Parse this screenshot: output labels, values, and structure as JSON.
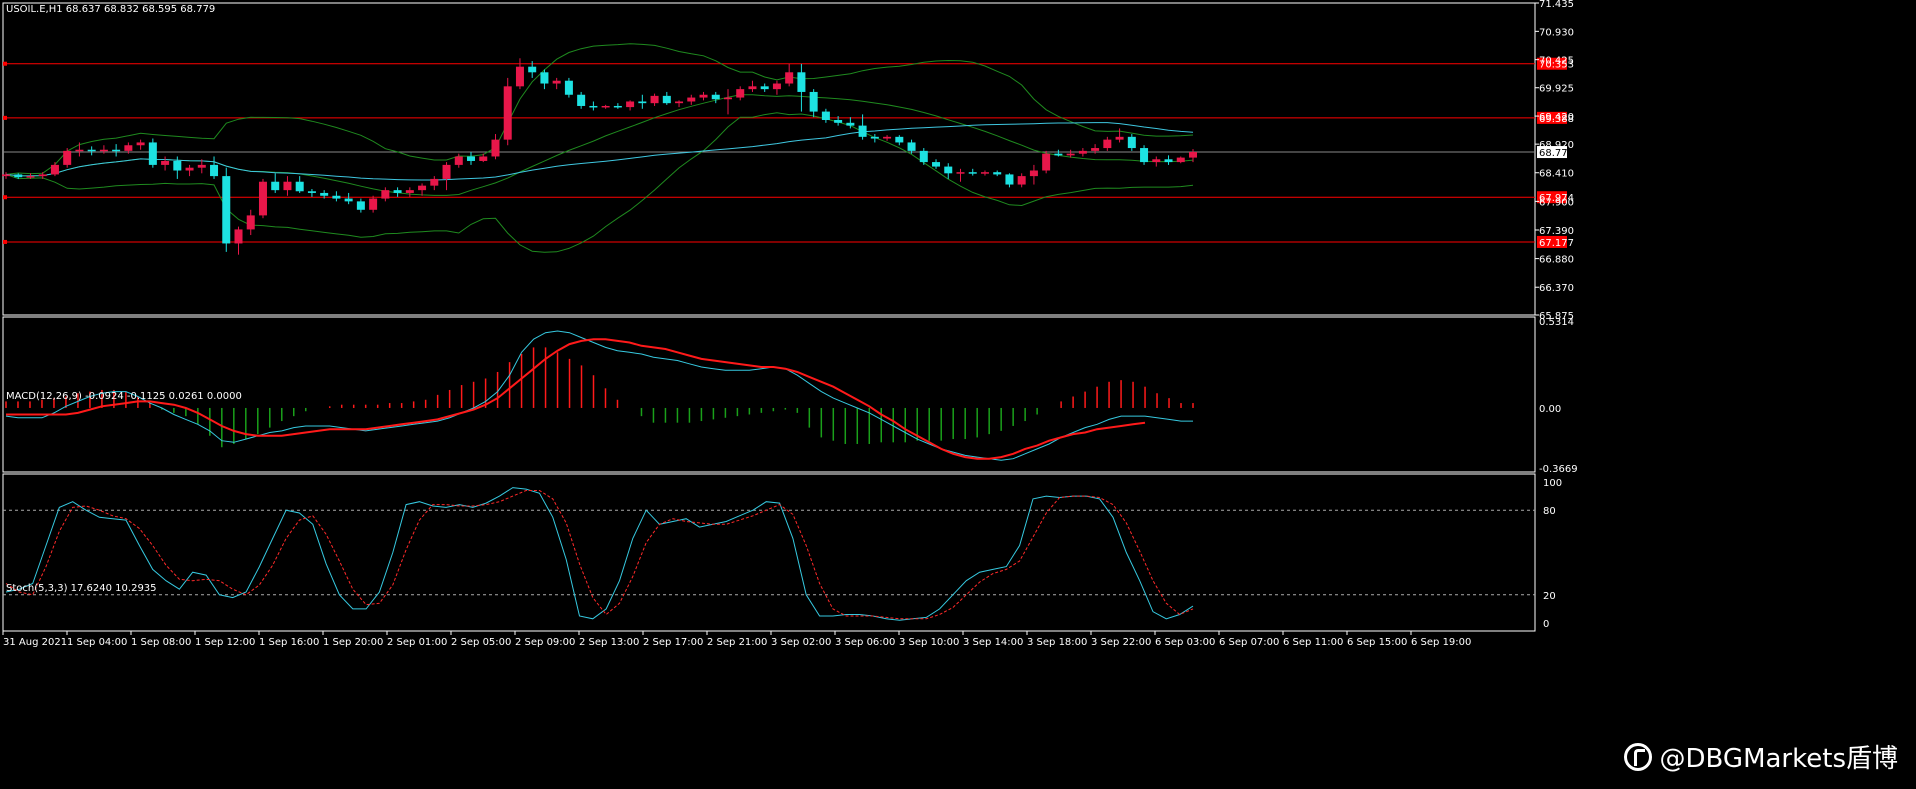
{
  "colors": {
    "background": "#000000",
    "frame": "#ffffff",
    "bull": "#e8174a",
    "bear": "#1de2e2",
    "level": "#ff0000",
    "bands": "#1f8a1f",
    "ma": "#3fc7e0",
    "macd_main": "#ff1a1a",
    "macd_signal": "#36c9e0",
    "hist_pos": "#ff1a1a",
    "hist_neg": "#1aa01a",
    "stoch_main": "#36c9e0",
    "stoch_signal": "#ff2a2a",
    "label_bg": "#ff0000",
    "price_bg": "#ffffff"
  },
  "header": {
    "symbol_info": "USOIL.E,H1  68.637 68.832 68.595 68.779"
  },
  "macd_header": "MACD(12,26,9) -0.0924 -0.1125 0.0261 0.0000",
  "stoch_header": "Stoch(5,3,3) 17.6240 10.2935",
  "watermark": "@DBGMarkets盾博",
  "chart_data": [
    {
      "type": "candlestick",
      "title": "USOIL.E,H1",
      "ohlc_last": [
        68.637,
        68.832,
        68.595,
        68.779
      ],
      "ylim": [
        65.875,
        71.435
      ],
      "yticks": [
        71.435,
        70.93,
        70.425,
        69.925,
        69.42,
        68.92,
        68.41,
        67.9,
        67.39,
        66.88,
        66.37,
        65.875
      ],
      "ytick_labels": [
        "71.435",
        "70.930",
        "70.425",
        "69.925",
        "69.420",
        "68.920",
        "68.410",
        "67.900",
        "67.390",
        "66.880",
        "66.370",
        "65.875"
      ],
      "levels": [
        {
          "value": 70.353,
          "label": "70.353"
        },
        {
          "value": 69.388,
          "label": "69.388"
        },
        {
          "value": 67.974,
          "label": "67.974"
        },
        {
          "value": 67.177,
          "label": "67.177"
        }
      ],
      "current_price": {
        "value": 68.779,
        "label": "68.779"
      },
      "x_labels": [
        "31 Aug 2021",
        "1 Sep 04:00",
        "1 Sep 08:00",
        "1 Sep 12:00",
        "1 Sep 16:00",
        "1 Sep 20:00",
        "2 Sep 01:00",
        "2 Sep 05:00",
        "2 Sep 09:00",
        "2 Sep 13:00",
        "2 Sep 17:00",
        "2 Sep 21:00",
        "3 Sep 02:00",
        "3 Sep 06:00",
        "3 Sep 10:00",
        "3 Sep 14:00",
        "3 Sep 18:00",
        "3 Sep 22:00",
        "6 Sep 03:00",
        "6 Sep 07:00",
        "6 Sep 11:00",
        "6 Sep 15:00",
        "6 Sep 19:00"
      ],
      "candles": [
        [
          68.35,
          68.42,
          68.3,
          68.38
        ],
        [
          68.38,
          68.4,
          68.3,
          68.33
        ],
        [
          68.33,
          68.4,
          68.3,
          68.35
        ],
        [
          68.35,
          68.42,
          68.3,
          68.38
        ],
        [
          68.38,
          68.6,
          68.35,
          68.55
        ],
        [
          68.55,
          68.85,
          68.5,
          68.8
        ],
        [
          68.8,
          68.95,
          68.7,
          68.82
        ],
        [
          68.82,
          68.88,
          68.72,
          68.8
        ],
        [
          68.8,
          68.9,
          68.75,
          68.82
        ],
        [
          68.82,
          68.92,
          68.7,
          68.8
        ],
        [
          68.8,
          68.95,
          68.75,
          68.9
        ],
        [
          68.9,
          69.0,
          68.82,
          68.95
        ],
        [
          68.95,
          69.02,
          68.5,
          68.55
        ],
        [
          68.55,
          68.7,
          68.45,
          68.62
        ],
        [
          68.62,
          68.7,
          68.3,
          68.45
        ],
        [
          68.45,
          68.55,
          68.35,
          68.5
        ],
        [
          68.5,
          68.65,
          68.4,
          68.55
        ],
        [
          68.55,
          68.7,
          68.3,
          68.35
        ],
        [
          68.35,
          68.5,
          67.0,
          67.15
        ],
        [
          67.15,
          67.45,
          66.95,
          67.4
        ],
        [
          67.4,
          67.75,
          67.3,
          67.65
        ],
        [
          67.65,
          68.3,
          67.6,
          68.25
        ],
        [
          68.25,
          68.4,
          68.05,
          68.1
        ],
        [
          68.1,
          68.35,
          68.0,
          68.25
        ],
        [
          68.25,
          68.35,
          68.05,
          68.08
        ],
        [
          68.08,
          68.12,
          67.98,
          68.05
        ],
        [
          68.05,
          68.1,
          67.95,
          68.0
        ],
        [
          68.0,
          68.08,
          67.9,
          67.95
        ],
        [
          67.95,
          68.05,
          67.85,
          67.9
        ],
        [
          67.9,
          67.95,
          67.7,
          67.75
        ],
        [
          67.75,
          68.0,
          67.7,
          67.95
        ],
        [
          67.95,
          68.15,
          67.9,
          68.1
        ],
        [
          68.1,
          68.15,
          67.98,
          68.05
        ],
        [
          68.05,
          68.15,
          67.98,
          68.1
        ],
        [
          68.1,
          68.22,
          68.0,
          68.18
        ],
        [
          68.18,
          68.35,
          68.1,
          68.3
        ],
        [
          68.3,
          68.6,
          68.1,
          68.55
        ],
        [
          68.55,
          68.75,
          68.5,
          68.7
        ],
        [
          68.7,
          68.78,
          68.55,
          68.62
        ],
        [
          68.62,
          68.75,
          68.6,
          68.7
        ],
        [
          68.7,
          69.1,
          68.65,
          69.0
        ],
        [
          69.0,
          70.1,
          68.9,
          69.95
        ],
        [
          69.95,
          70.45,
          69.9,
          70.3
        ],
        [
          70.3,
          70.4,
          70.1,
          70.2
        ],
        [
          70.2,
          70.25,
          69.9,
          70.0
        ],
        [
          70.0,
          70.1,
          69.9,
          70.05
        ],
        [
          70.05,
          70.1,
          69.75,
          69.8
        ],
        [
          69.8,
          69.85,
          69.55,
          69.6
        ],
        [
          69.6,
          69.68,
          69.52,
          69.58
        ],
        [
          69.58,
          69.62,
          69.55,
          69.6
        ],
        [
          69.6,
          69.65,
          69.55,
          69.58
        ],
        [
          69.58,
          69.7,
          69.52,
          69.68
        ],
        [
          69.68,
          69.8,
          69.55,
          69.65
        ],
        [
          69.65,
          69.82,
          69.6,
          69.78
        ],
        [
          69.78,
          69.85,
          69.62,
          69.65
        ],
        [
          69.65,
          69.7,
          69.58,
          69.68
        ],
        [
          69.68,
          69.8,
          69.62,
          69.75
        ],
        [
          69.75,
          69.85,
          69.7,
          69.8
        ],
        [
          69.8,
          69.85,
          69.65,
          69.72
        ],
        [
          69.72,
          69.9,
          69.45,
          69.75
        ],
        [
          69.75,
          69.95,
          69.7,
          69.9
        ],
        [
          69.9,
          70.05,
          69.85,
          69.95
        ],
        [
          69.95,
          70.0,
          69.85,
          69.9
        ],
        [
          69.9,
          70.05,
          69.8,
          70.0
        ],
        [
          70.0,
          70.35,
          69.95,
          70.2
        ],
        [
          70.2,
          70.35,
          69.5,
          69.85
        ],
        [
          69.85,
          69.9,
          69.4,
          69.5
        ],
        [
          69.5,
          69.55,
          69.3,
          69.35
        ],
        [
          69.35,
          69.42,
          69.25,
          69.3
        ],
        [
          69.3,
          69.4,
          69.2,
          69.25
        ],
        [
          69.25,
          69.45,
          69.0,
          69.05
        ],
        [
          69.05,
          69.1,
          68.95,
          69.02
        ],
        [
          69.02,
          69.08,
          68.98,
          69.05
        ],
        [
          69.05,
          69.08,
          68.9,
          68.95
        ],
        [
          68.95,
          69.0,
          68.75,
          68.8
        ],
        [
          68.8,
          68.85,
          68.55,
          68.6
        ],
        [
          68.6,
          68.65,
          68.48,
          68.52
        ],
        [
          68.52,
          68.58,
          68.3,
          68.4
        ],
        [
          68.4,
          68.48,
          68.25,
          68.42
        ],
        [
          68.42,
          68.48,
          68.36,
          68.4
        ],
        [
          68.4,
          68.45,
          68.36,
          68.42
        ],
        [
          68.42,
          68.45,
          68.35,
          68.38
        ],
        [
          68.38,
          68.4,
          68.15,
          68.2
        ],
        [
          68.2,
          68.4,
          68.15,
          68.35
        ],
        [
          68.35,
          68.55,
          68.2,
          68.45
        ],
        [
          68.45,
          68.8,
          68.4,
          68.75
        ],
        [
          68.75,
          68.82,
          68.7,
          68.72
        ],
        [
          68.72,
          68.82,
          68.68,
          68.75
        ],
        [
          68.75,
          68.85,
          68.7,
          68.8
        ],
        [
          68.8,
          68.92,
          68.75,
          68.85
        ],
        [
          68.85,
          69.05,
          68.8,
          69.0
        ],
        [
          69.0,
          69.2,
          68.95,
          69.05
        ],
        [
          69.05,
          69.1,
          68.8,
          68.85
        ],
        [
          68.85,
          68.9,
          68.55,
          68.6
        ],
        [
          68.6,
          68.7,
          68.52,
          68.65
        ],
        [
          68.65,
          68.72,
          68.55,
          68.6
        ],
        [
          68.6,
          68.7,
          68.58,
          68.68
        ],
        [
          68.68,
          68.83,
          68.6,
          68.78
        ]
      ]
    },
    {
      "type": "bar",
      "title": "MACD(12,26,9)",
      "values_header": "-0.0924 -0.1125 0.0261 0.0000",
      "ylim": [
        -0.3669,
        0.5314
      ],
      "ytick_labels": [
        "0.5314",
        "0.00",
        "-0.3669"
      ],
      "histogram": [
        0.04,
        0.04,
        0.04,
        0.05,
        0.06,
        0.07,
        0.09,
        0.1,
        0.11,
        0.11,
        0.1,
        0.07,
        0.03,
        -0.01,
        -0.03,
        -0.05,
        -0.1,
        -0.17,
        -0.24,
        -0.22,
        -0.19,
        -0.16,
        -0.12,
        -0.08,
        -0.05,
        -0.02,
        0,
        0.01,
        0.02,
        0.02,
        0.02,
        0.02,
        0.03,
        0.03,
        0.04,
        0.05,
        0.08,
        0.11,
        0.14,
        0.16,
        0.18,
        0.22,
        0.28,
        0.33,
        0.37,
        0.37,
        0.34,
        0.3,
        0.26,
        0.2,
        0.12,
        0.05,
        0,
        -0.05,
        -0.09,
        -0.09,
        -0.09,
        -0.09,
        -0.08,
        -0.07,
        -0.06,
        -0.05,
        -0.04,
        -0.03,
        -0.02,
        -0.01,
        -0.03,
        -0.12,
        -0.18,
        -0.2,
        -0.22,
        -0.22,
        -0.22,
        -0.21,
        -0.21,
        -0.21,
        -0.2,
        -0.2,
        -0.2,
        -0.19,
        -0.19,
        -0.18,
        -0.16,
        -0.14,
        -0.11,
        -0.08,
        -0.04,
        0,
        0.04,
        0.07,
        0.1,
        0.13,
        0.16,
        0.17,
        0.16,
        0.13,
        0.09,
        0.06,
        0.03,
        0.03
      ],
      "main": [
        -0.05,
        -0.06,
        -0.06,
        -0.06,
        -0.03,
        0.01,
        0.04,
        0.07,
        0.09,
        0.1,
        0.1,
        0.07,
        0.03,
        0,
        -0.04,
        -0.07,
        -0.1,
        -0.14,
        -0.2,
        -0.21,
        -0.19,
        -0.17,
        -0.15,
        -0.14,
        -0.12,
        -0.11,
        -0.11,
        -0.11,
        -0.12,
        -0.13,
        -0.14,
        -0.13,
        -0.12,
        -0.11,
        -0.1,
        -0.09,
        -0.08,
        -0.06,
        -0.03,
        0,
        0.04,
        0.1,
        0.2,
        0.34,
        0.42,
        0.46,
        0.47,
        0.46,
        0.43,
        0.4,
        0.37,
        0.35,
        0.34,
        0.33,
        0.31,
        0.3,
        0.29,
        0.27,
        0.25,
        0.24,
        0.23,
        0.23,
        0.23,
        0.24,
        0.25,
        0.24,
        0.2,
        0.15,
        0.1,
        0.06,
        0.03,
        0,
        -0.03,
        -0.07,
        -0.11,
        -0.15,
        -0.19,
        -0.22,
        -0.25,
        -0.27,
        -0.29,
        -0.3,
        -0.31,
        -0.32,
        -0.31,
        -0.28,
        -0.25,
        -0.22,
        -0.18,
        -0.15,
        -0.12,
        -0.1,
        -0.07,
        -0.05,
        -0.05,
        -0.05,
        -0.06,
        -0.07,
        -0.08,
        -0.08
      ],
      "signal": [
        -0.04,
        -0.04,
        -0.04,
        -0.04,
        -0.04,
        -0.04,
        -0.03,
        -0.01,
        0.01,
        0.02,
        0.03,
        0.04,
        0.04,
        0.03,
        0.02,
        0,
        -0.03,
        -0.07,
        -0.11,
        -0.14,
        -0.16,
        -0.17,
        -0.17,
        -0.17,
        -0.16,
        -0.15,
        -0.14,
        -0.13,
        -0.13,
        -0.13,
        -0.13,
        -0.12,
        -0.11,
        -0.1,
        -0.09,
        -0.08,
        -0.07,
        -0.05,
        -0.03,
        -0.01,
        0.02,
        0.06,
        0.12,
        0.18,
        0.24,
        0.3,
        0.35,
        0.39,
        0.41,
        0.42,
        0.42,
        0.41,
        0.4,
        0.38,
        0.37,
        0.36,
        0.34,
        0.32,
        0.3,
        0.29,
        0.28,
        0.27,
        0.26,
        0.25,
        0.25,
        0.24,
        0.22,
        0.19,
        0.16,
        0.13,
        0.09,
        0.05,
        0.01,
        -0.04,
        -0.08,
        -0.13,
        -0.17,
        -0.21,
        -0.25,
        -0.28,
        -0.3,
        -0.31,
        -0.31,
        -0.3,
        -0.28,
        -0.25,
        -0.23,
        -0.2,
        -0.18,
        -0.16,
        -0.15,
        -0.13,
        -0.12,
        -0.11,
        -0.1,
        -0.09
      ]
    },
    {
      "type": "line",
      "title": "Stoch(5,3,3)",
      "values_header": "17.6240 10.2935",
      "ylim": [
        0,
        100
      ],
      "ytick_labels": [
        "100",
        "80",
        "20",
        "0"
      ],
      "levels": [
        80,
        20
      ],
      "main": [
        22,
        24,
        28,
        55,
        82,
        86,
        80,
        75,
        74,
        73,
        55,
        38,
        30,
        24,
        36,
        34,
        20,
        18,
        22,
        40,
        60,
        80,
        78,
        70,
        42,
        20,
        10,
        10,
        22,
        50,
        84,
        86,
        83,
        82,
        84,
        82,
        85,
        90,
        96,
        95,
        92,
        75,
        45,
        5,
        3,
        10,
        30,
        60,
        80,
        70,
        72,
        74,
        68,
        70,
        72,
        76,
        80,
        86,
        85,
        60,
        20,
        5,
        5,
        6,
        6,
        5,
        3,
        2,
        3,
        4,
        10,
        20,
        30,
        36,
        38,
        40,
        55,
        88,
        90,
        89,
        90,
        90,
        88,
        75,
        50,
        30,
        8,
        3,
        6,
        12
      ],
      "signal": [
        28,
        22,
        20,
        40,
        65,
        82,
        83,
        80,
        76,
        74,
        67,
        55,
        41,
        31,
        30,
        31,
        30,
        24,
        20,
        27,
        41,
        60,
        73,
        76,
        63,
        44,
        24,
        13,
        14,
        27,
        52,
        73,
        84,
        84,
        83,
        83,
        84,
        86,
        90,
        94,
        94,
        88,
        71,
        42,
        18,
        6,
        14,
        33,
        57,
        70,
        74,
        72,
        71,
        70,
        70,
        73,
        76,
        80,
        84,
        77,
        55,
        28,
        10,
        5,
        5,
        5,
        4,
        3,
        3,
        3,
        6,
        11,
        20,
        29,
        35,
        38,
        44,
        61,
        78,
        89,
        90,
        90,
        89,
        84,
        71,
        51,
        30,
        14,
        6,
        10
      ]
    }
  ]
}
